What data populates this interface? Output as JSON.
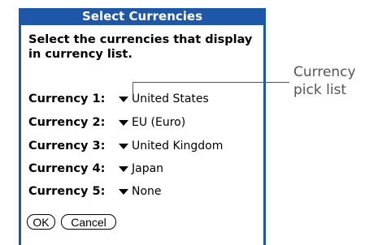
{
  "dialog": {
    "title": "Select Currencies",
    "instruction": "Select the currencies that display in currency list.",
    "rows": [
      {
        "label": "Currency 1:",
        "value": "United States"
      },
      {
        "label": "Currency 2:",
        "value": "EU (Euro)"
      },
      {
        "label": "Currency 3:",
        "value": "United Kingdom"
      },
      {
        "label": "Currency 4:",
        "value": "Japan"
      },
      {
        "label": "Currency 5:",
        "value": "None"
      }
    ],
    "buttons": {
      "ok_label": "OK",
      "cancel_label": "Cancel"
    }
  },
  "callout": {
    "text_line1": "Currency",
    "text_line2": "pick list"
  },
  "colors": {
    "titlebar": "#1f57a8",
    "callout": "#555555"
  },
  "icons": {
    "pick_list_arrow": "triangle-down-icon"
  }
}
